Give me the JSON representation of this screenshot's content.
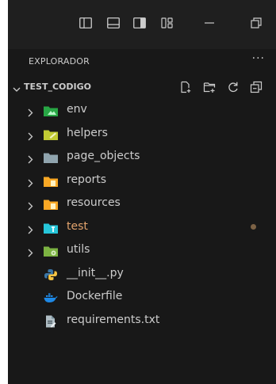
{
  "explorer": {
    "title": "EXPLORADOR",
    "more": "···"
  },
  "workspace": {
    "name": "TEST_CODIGO"
  },
  "tree": [
    {
      "label": "env",
      "type": "folder",
      "icon": "folder-env-icon",
      "color": "#28a745"
    },
    {
      "label": "helpers",
      "type": "folder",
      "icon": "folder-helper-icon",
      "color": "#c0ca33"
    },
    {
      "label": "page_objects",
      "type": "folder",
      "icon": "folder-icon",
      "color": "#90a4ae"
    },
    {
      "label": "reports",
      "type": "folder",
      "icon": "folder-reports-icon",
      "color": "#f9a825"
    },
    {
      "label": "resources",
      "type": "folder",
      "icon": "folder-resources-icon",
      "color": "#f9a825"
    },
    {
      "label": "test",
      "type": "folder",
      "icon": "folder-test-icon",
      "color": "#26c6da",
      "modified": true
    },
    {
      "label": "utils",
      "type": "folder",
      "icon": "folder-utils-icon",
      "color": "#7cb342"
    },
    {
      "label": "__init__.py",
      "type": "file",
      "icon": "python-icon"
    },
    {
      "label": "Dockerfile",
      "type": "file",
      "icon": "docker-icon"
    },
    {
      "label": "requirements.txt",
      "type": "file",
      "icon": "text-file-icon"
    }
  ],
  "colors": {
    "background": "#181818",
    "titlebar": "#1f1f1f",
    "modified": "#e2a36d"
  }
}
